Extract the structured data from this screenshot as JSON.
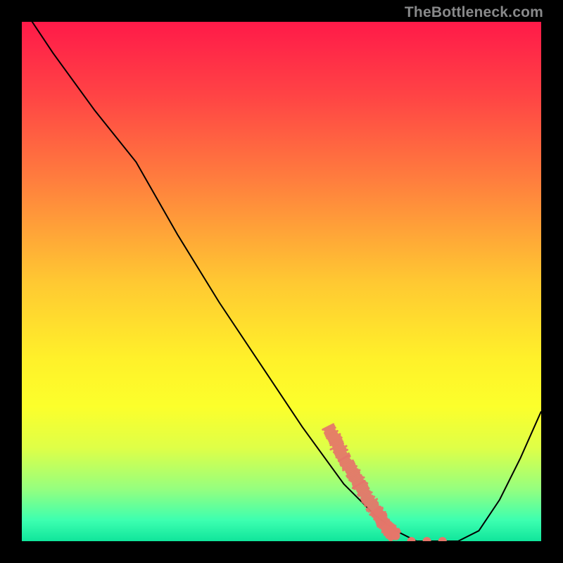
{
  "watermark": "TheBottleneck.com",
  "chart_data": {
    "type": "line",
    "title": "",
    "xlabel": "",
    "ylabel": "",
    "xlim": [
      0,
      100
    ],
    "ylim": [
      0,
      100
    ],
    "background_gradient": {
      "stops": [
        {
          "pct": 0,
          "color": "#ff1a49"
        },
        {
          "pct": 14,
          "color": "#ff4345"
        },
        {
          "pct": 30,
          "color": "#ff7c3e"
        },
        {
          "pct": 50,
          "color": "#ffc832"
        },
        {
          "pct": 65,
          "color": "#fff12a"
        },
        {
          "pct": 74,
          "color": "#fcff2b"
        },
        {
          "pct": 82,
          "color": "#dfff47"
        },
        {
          "pct": 90,
          "color": "#95ff7f"
        },
        {
          "pct": 96,
          "color": "#3cffb0"
        },
        {
          "pct": 100,
          "color": "#10e59b"
        }
      ]
    },
    "series": [
      {
        "name": "bottleneck-curve",
        "color": "#000000",
        "x": [
          0,
          6,
          14,
          22,
          30,
          38,
          46,
          54,
          62,
          68,
          72,
          76,
          80,
          84,
          88,
          92,
          96,
          100
        ],
        "y": [
          103,
          94,
          83,
          73,
          59,
          46,
          34,
          22,
          11,
          5,
          2,
          0,
          0,
          0,
          2,
          8,
          16,
          25
        ]
      }
    ],
    "highlight_markers": {
      "name": "optimal-range",
      "color": "#e5766a",
      "points": [
        {
          "x": 59,
          "y": 22
        },
        {
          "x": 62,
          "y": 16
        },
        {
          "x": 65,
          "y": 11
        },
        {
          "x": 68,
          "y": 6
        },
        {
          "x": 70,
          "y": 3
        },
        {
          "x": 72,
          "y": 1
        },
        {
          "x": 75,
          "y": 0
        },
        {
          "x": 78,
          "y": 0
        },
        {
          "x": 81,
          "y": 0
        }
      ]
    }
  }
}
